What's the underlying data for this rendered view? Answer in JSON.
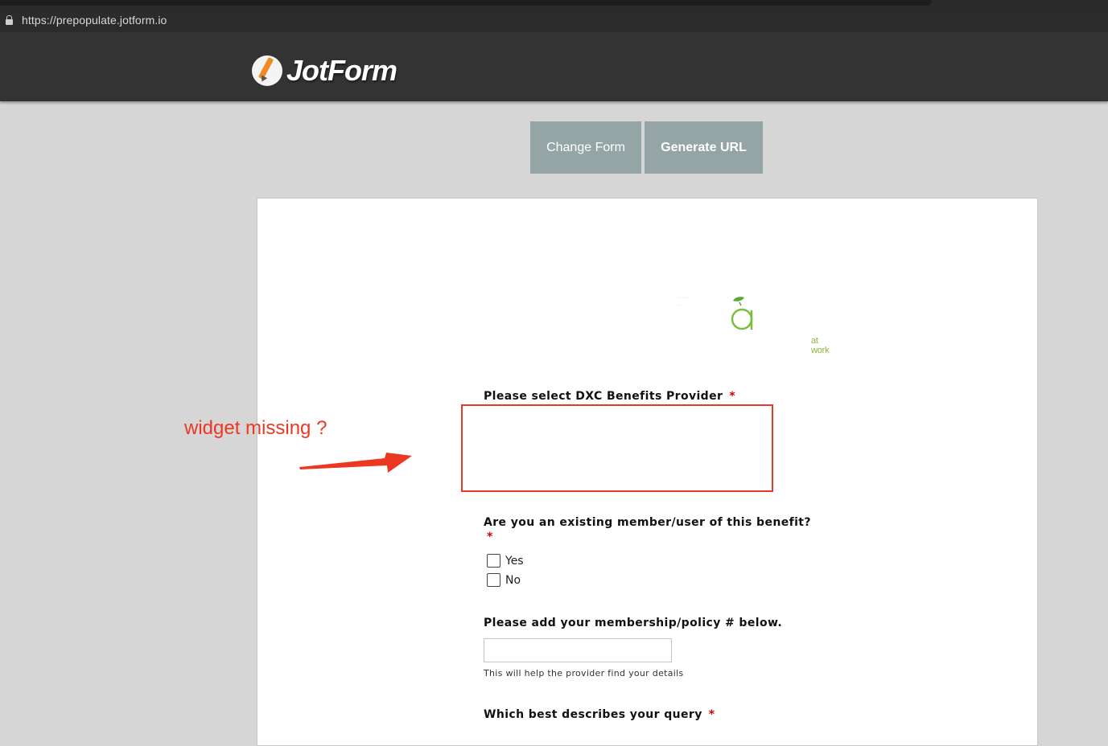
{
  "browser": {
    "url": "https://prepopulate.jotform.io"
  },
  "app": {
    "logo_text": "JotForm"
  },
  "toolbar": {
    "change_form_label": "Change Form",
    "generate_url_label": "Generate URL"
  },
  "form": {
    "brand_tagline": "at work",
    "questions": [
      {
        "label": "Please select DXC Benefits Provider",
        "required_mark": "*"
      },
      {
        "label": "Are you an existing member/user of this benefit?",
        "required_mark": "*",
        "options": [
          "Yes",
          "No"
        ]
      },
      {
        "label": "Please add your membership/policy # below.",
        "value": "",
        "hint": "This will help the provider find your details"
      },
      {
        "label": "Which best describes your query",
        "required_mark": "*"
      }
    ]
  },
  "annotation": {
    "text": "widget missing ?",
    "color": "#ec3822"
  },
  "colors": {
    "button_bg": "#95a5a6",
    "header_bg": "#333333",
    "page_bg": "#d6d6d6",
    "required": "#d40000"
  }
}
